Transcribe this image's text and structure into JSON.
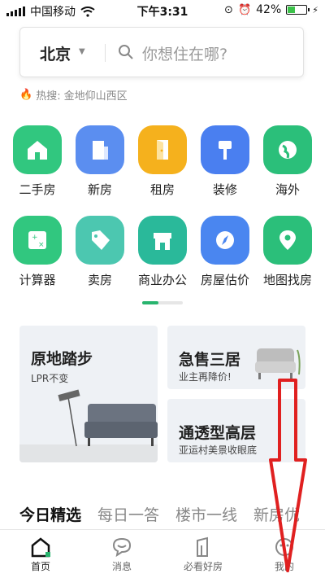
{
  "status_bar": {
    "carrier": "中国移动",
    "time": "下午3:31",
    "battery": "42%",
    "battery_level": 0.42
  },
  "search": {
    "city": "北京",
    "placeholder": "你想住在哪?"
  },
  "hot": {
    "prefix": "热搜:",
    "text": "金地仰山西区"
  },
  "grid": [
    {
      "label": "二手房",
      "icon": "house-icon",
      "color": "#31c77f"
    },
    {
      "label": "新房",
      "icon": "building-icon",
      "color": "#5b8ef0"
    },
    {
      "label": "租房",
      "icon": "door-icon",
      "color": "#f5b11d"
    },
    {
      "label": "装修",
      "icon": "brush-icon",
      "color": "#4a7ff0"
    },
    {
      "label": "海外",
      "icon": "globe-icon",
      "color": "#2bbf7a"
    },
    {
      "label": "计算器",
      "icon": "calculator-icon",
      "color": "#31c77f"
    },
    {
      "label": "卖房",
      "icon": "tag-icon",
      "color": "#4cc7b0"
    },
    {
      "label": "商业办公",
      "icon": "shop-icon",
      "color": "#2ab99a"
    },
    {
      "label": "房屋估价",
      "icon": "compass-icon",
      "color": "#4a86f0"
    },
    {
      "label": "地图找房",
      "icon": "map-pin-icon",
      "color": "#2bbf7a"
    }
  ],
  "banners": {
    "b1": {
      "title": "原地踏步",
      "sub": "LPR不变"
    },
    "b2": {
      "title": "急售三居",
      "sub": "业主再降价!"
    },
    "b3": {
      "title": "通透型高层",
      "sub": "亚运村美景收眼底"
    }
  },
  "tabs": [
    "今日精选",
    "每日一答",
    "楼市一线",
    "新房优"
  ],
  "nav": [
    "首页",
    "消息",
    "必看好房",
    "我的"
  ],
  "colors": {
    "accent": "#28b46e",
    "arrow": "#e02020"
  }
}
